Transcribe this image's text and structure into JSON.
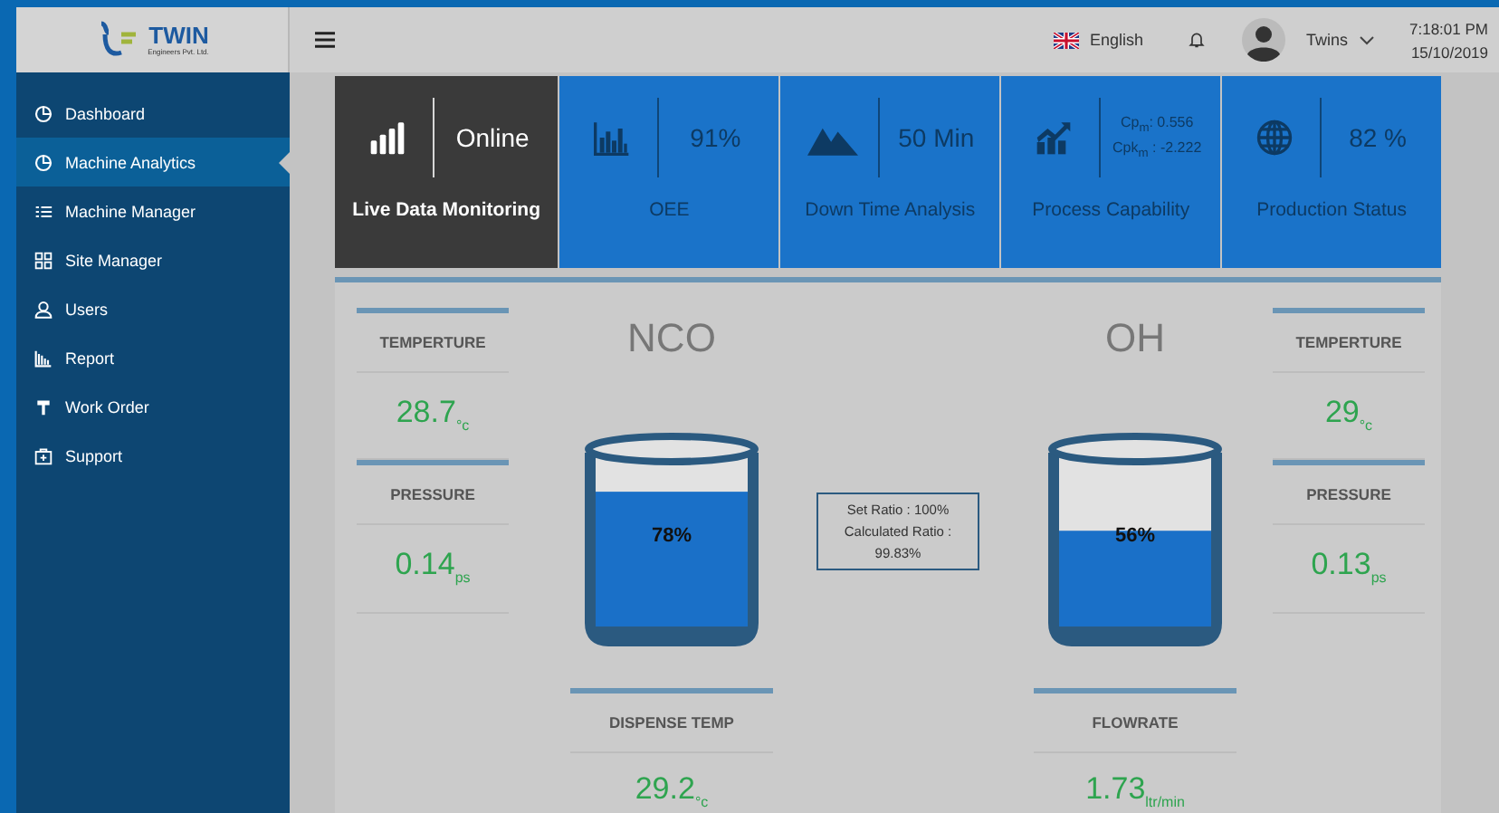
{
  "logo": {
    "name": "TWIN",
    "tagline": "Engineers Pvt. Ltd."
  },
  "sidebar": {
    "items": [
      {
        "label": "Dashboard",
        "kind": "pie",
        "selected": false
      },
      {
        "label": "Machine Analytics",
        "kind": "pie",
        "selected": true
      },
      {
        "label": "Machine Manager",
        "kind": "list",
        "selected": false
      },
      {
        "label": "Site Manager",
        "kind": "grid",
        "selected": false
      },
      {
        "label": "Users",
        "kind": "user",
        "selected": false
      },
      {
        "label": "Report",
        "kind": "report",
        "selected": false
      },
      {
        "label": "Work Order",
        "kind": "tool",
        "selected": false
      },
      {
        "label": "Support",
        "kind": "kit",
        "selected": false
      }
    ]
  },
  "header": {
    "language": "English",
    "user": "Twins",
    "time": "7:18:01 PM",
    "date": "15/10/2019"
  },
  "tiles": [
    {
      "kind": "signal",
      "values": [
        "Online"
      ],
      "label": "Live Data Monitoring",
      "selected": true
    },
    {
      "kind": "bars",
      "values": [
        "91%"
      ],
      "label": "OEE",
      "selected": false
    },
    {
      "kind": "mountain",
      "values": [
        "50 Min"
      ],
      "label": "Down Time Analysis",
      "selected": false
    },
    {
      "kind": "trend",
      "values": [
        "Cp$_{m}$: 0.556",
        "Cpk$_{m}$ : -2.222"
      ],
      "label": "Process Capability",
      "selected": false
    },
    {
      "kind": "globe",
      "values": [
        "82 %"
      ],
      "label": "Production Status",
      "selected": false
    }
  ],
  "tanks": [
    {
      "name": "NCO",
      "level": 0.78,
      "reading": "78%",
      "stats": [
        {
          "label": "TEMPERTURE",
          "value": "28.7",
          "unit": "°c"
        },
        {
          "label": "PRESSURE",
          "value": "0.14",
          "unit": "ps"
        }
      ],
      "bottom": {
        "label": "DISPENSE TEMP",
        "value": "29.2",
        "unit": "°c"
      }
    },
    {
      "name": "OH",
      "level": 0.56,
      "reading": "56%",
      "stats": [
        {
          "label": "TEMPERTURE",
          "value": "29",
          "unit": "°c"
        },
        {
          "label": "PRESSURE",
          "value": "0.13",
          "unit": "ps"
        }
      ],
      "bottom": {
        "label": "FLOWRATE",
        "value": "1.73",
        "unit": "ltr/min"
      }
    }
  ],
  "ratio": {
    "lines": [
      "Set Ratio : 100%",
      "Calculated Ratio :",
      "99.83%"
    ]
  }
}
